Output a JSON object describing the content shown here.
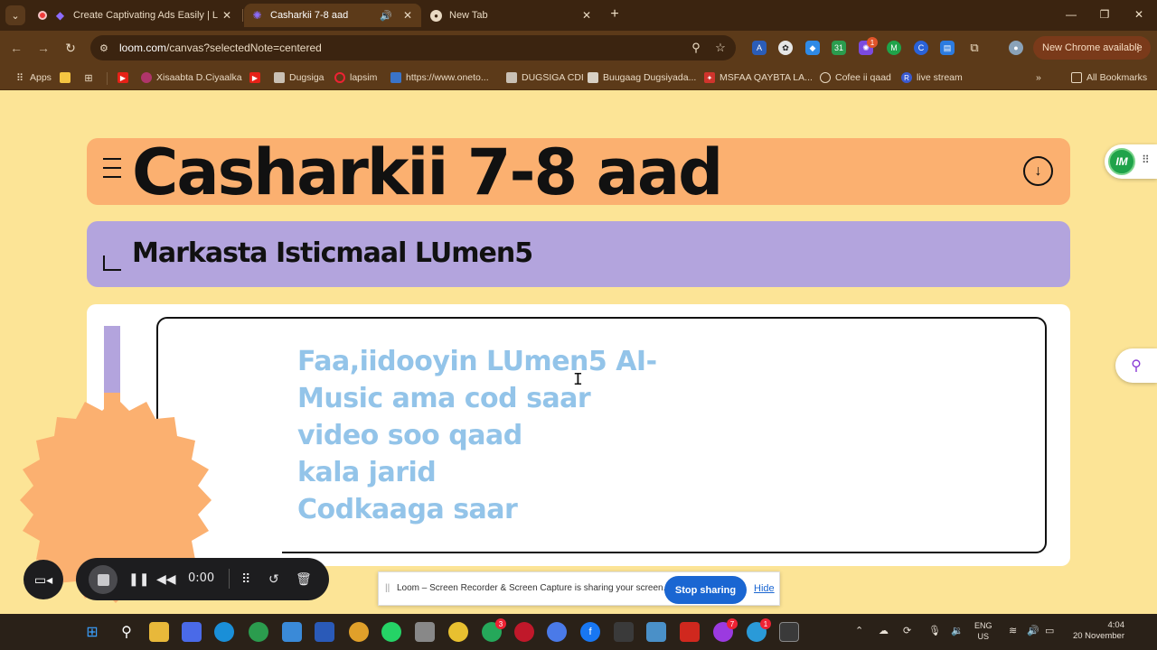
{
  "browser": {
    "tabs": [
      {
        "title": "Create Captivating Ads Easily | L",
        "active": false
      },
      {
        "title": "Casharkii 7-8 aad",
        "active": true
      },
      {
        "title": "New Tab",
        "active": false
      }
    ],
    "url_domain": "loom.com",
    "url_path": "/canvas?selectedNote=centered",
    "update_label": "New Chrome available",
    "bookmarks": [
      "Apps",
      "Xisaabta D.Ciyaalka",
      "Dugsiga",
      "lapsim",
      "https://www.oneto...",
      "DUGSIGA CDI",
      "Buugaag Dugsiyada...",
      "MSFAA QAYBTA LA...",
      "Cofee ii qaad",
      "live stream"
    ],
    "all_bookmarks_label": "All Bookmarks"
  },
  "page": {
    "title": "Casharkii 7-8 aad",
    "subtitle": "Markasta Isticmaal LUmen5",
    "body_lines": [
      "Faa,iidooyin LUmen5 AI-",
      "Music ama cod saar",
      "video soo qaad",
      "kala jarid",
      "Codkaaga saar"
    ],
    "widget_logo": "IM"
  },
  "loom": {
    "time": "0:00",
    "share_message": "Loom – Screen Recorder & Screen Capture is sharing your screen.",
    "stop_label": "Stop sharing",
    "hide_label": "Hide"
  },
  "taskbar": {
    "badges": [
      "3",
      "7",
      "1"
    ],
    "lang_line1": "ENG",
    "lang_line2": "US",
    "time": "4:04",
    "date": "20 November"
  },
  "colors": {
    "background": "#fce496",
    "title_card": "#fbb070",
    "subtitle_card": "#b3a4dd",
    "body_text": "#93c4e9",
    "stop_button": "#1a66d2"
  }
}
